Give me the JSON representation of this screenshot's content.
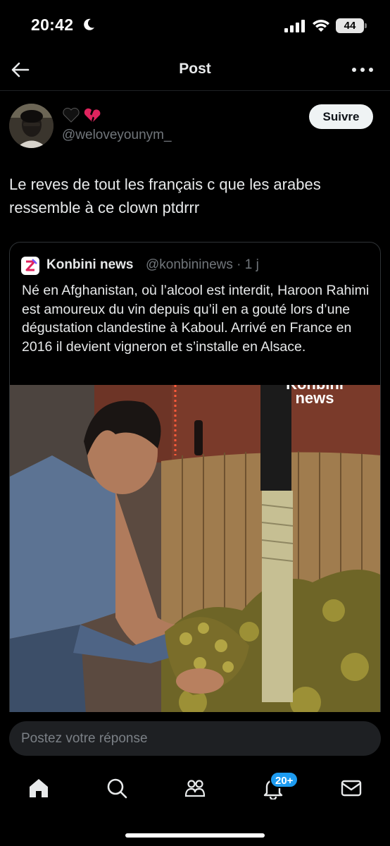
{
  "status_bar": {
    "time": "20:42",
    "battery": "44"
  },
  "nav": {
    "title": "Post"
  },
  "post": {
    "author_handle": "@weloveyounym_",
    "follow_label": "Suivre",
    "text": "Le reves de tout les français c que les arabes ressemble à ce clown ptdrrr"
  },
  "quote": {
    "name": "Konbini news",
    "meta": "@konbininews · 1 j",
    "text": "Né en Afghanistan, où l’alcool est interdit, Haroon Rahimi est amoureux du vin depuis qu’il en a gouté lors d’une dégustation clandestine à Kaboul. Arrivé en France en 2016 il devient vigneron et s’installe en Alsace.",
    "watermark_line1": "Konbini",
    "watermark_line2": "news"
  },
  "reply": {
    "placeholder": "Postez votre réponse"
  },
  "tabbar": {
    "notifications_badge": "20+"
  },
  "icons": [
    "moon-icon",
    "signal-icon",
    "wifi-icon",
    "back-arrow-icon",
    "more-icon",
    "black-heart-icon",
    "broken-heart-icon",
    "home-icon",
    "search-icon",
    "communities-icon",
    "notifications-bell-icon",
    "messages-icon"
  ],
  "colors": {
    "background": "#000000",
    "text": "#e7e9ea",
    "muted": "#71767b",
    "accent": "#1d9bf0",
    "follow_bg": "#eff3f4"
  }
}
